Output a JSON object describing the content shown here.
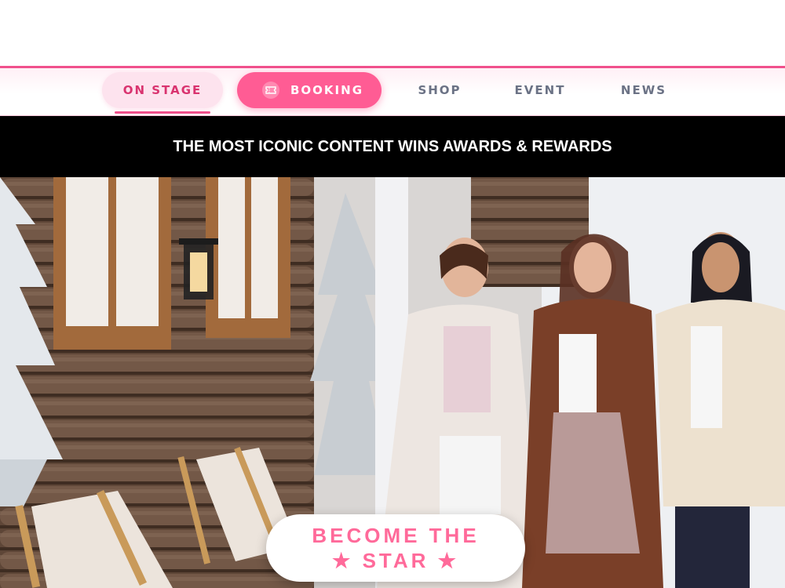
{
  "nav": {
    "on_stage": "ON STAGE",
    "booking": "BOOKING",
    "shop": "SHOP",
    "event": "EVENT",
    "news": "NEWS"
  },
  "banner": {
    "text": "THE MOST ICONIC CONTENT WINS AWARDS & REWARDS"
  },
  "hero": {
    "cta_line1": "BECOME THE",
    "cta_line2": "★ STAR ★"
  },
  "colors": {
    "accent": "#f0508c",
    "booking_bg": "#ff5c94",
    "cta_text": "#ff6a9a",
    "banner_bg": "#000000"
  },
  "icons": [
    "ticket-icon"
  ]
}
